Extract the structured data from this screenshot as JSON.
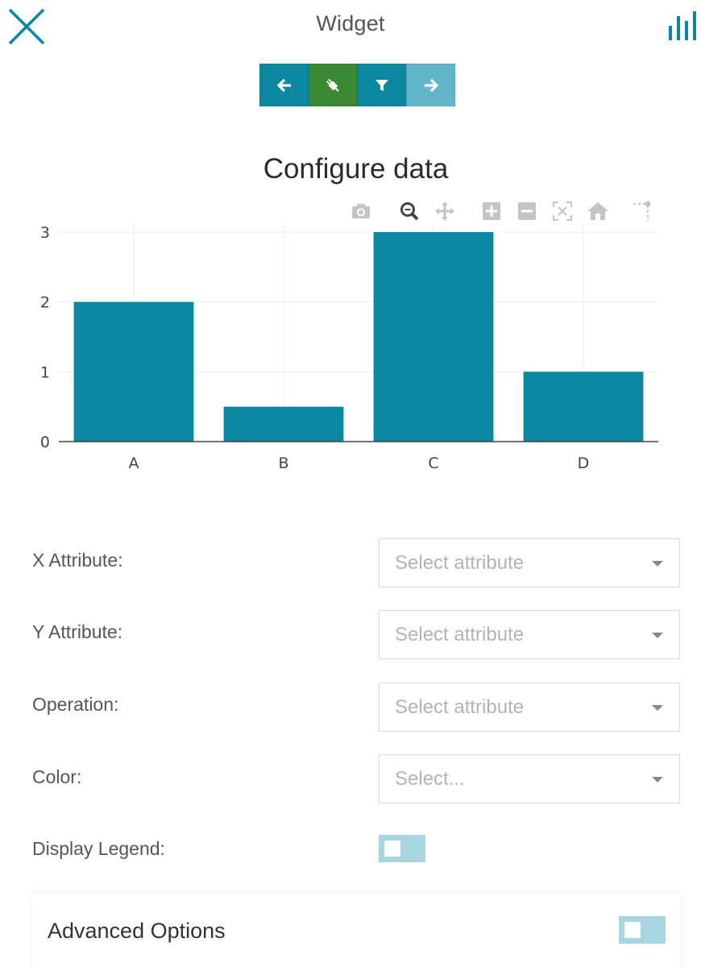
{
  "header": {
    "title": "Widget"
  },
  "toolbar": {
    "buttons": [
      {
        "name": "back",
        "icon": "arrow-left-icon",
        "color": "#0b87a1"
      },
      {
        "name": "connect",
        "icon": "plug-icon",
        "color": "#3b8a33"
      },
      {
        "name": "filter",
        "icon": "filter-icon",
        "color": "#0b87a1"
      },
      {
        "name": "next",
        "icon": "arrow-right-icon",
        "color": "#62b5c9"
      }
    ]
  },
  "modebar": {
    "icons": [
      "camera-icon",
      "zoom-icon",
      "pan-icon",
      "zoom-in-icon",
      "zoom-out-icon",
      "autoscale-icon",
      "reset-axes-icon",
      "spike-lines-icon"
    ]
  },
  "chart_data": {
    "type": "bar",
    "title": "Configure data",
    "categories": [
      "A",
      "B",
      "C",
      "D"
    ],
    "values": [
      2,
      0.5,
      3,
      1
    ],
    "ylim": [
      0,
      3
    ],
    "yticks": [
      0,
      1,
      2,
      3
    ],
    "grid": true,
    "bar_color": "#0b87a1"
  },
  "form": {
    "x_attribute": {
      "label": "X Attribute:",
      "placeholder": "Select attribute"
    },
    "y_attribute": {
      "label": "Y Attribute:",
      "placeholder": "Select attribute"
    },
    "operation": {
      "label": "Operation:",
      "placeholder": "Select attribute"
    },
    "color": {
      "label": "Color:",
      "placeholder": "Select..."
    },
    "display_legend": {
      "label": "Display Legend:",
      "on": false
    }
  },
  "advanced": {
    "title": "Advanced Options",
    "on": false
  },
  "colors": {
    "accent": "#0b87a1",
    "toggle": "#a7d6e2"
  }
}
